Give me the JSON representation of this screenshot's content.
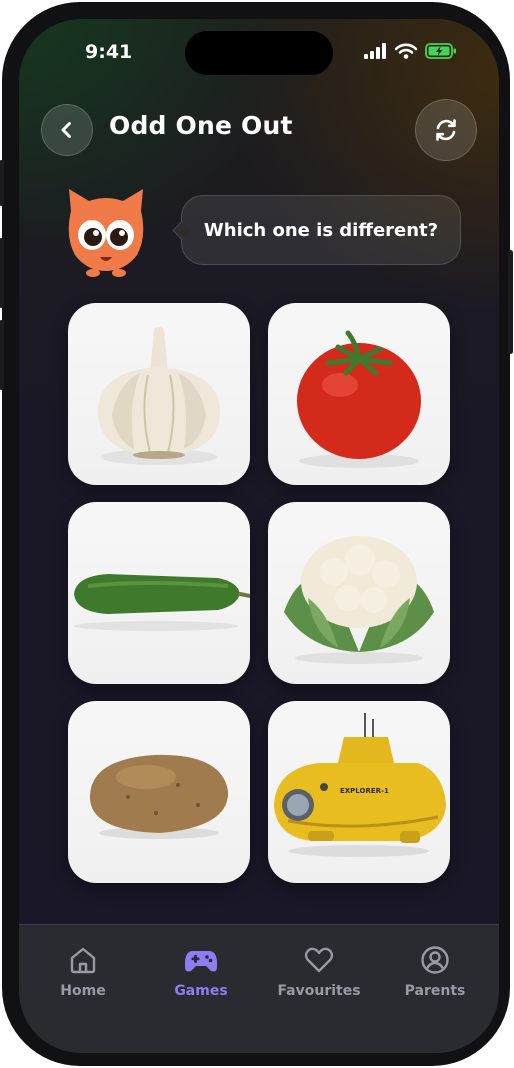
{
  "status_bar": {
    "time": "9:41"
  },
  "header": {
    "title": "Odd One Out"
  },
  "prompt": {
    "text": "Which one is different?"
  },
  "cards": [
    {
      "item": "garlic"
    },
    {
      "item": "tomato"
    },
    {
      "item": "cucumber"
    },
    {
      "item": "cauliflower"
    },
    {
      "item": "potato"
    },
    {
      "item": "submarine",
      "caption": "EXPLORER-1"
    }
  ],
  "nav": {
    "items": [
      {
        "label": "Home",
        "icon": "home-icon",
        "active": false
      },
      {
        "label": "Games",
        "icon": "gamepad-icon",
        "active": true
      },
      {
        "label": "Favourites",
        "icon": "heart-icon",
        "active": false
      },
      {
        "label": "Parents",
        "icon": "user-circle-icon",
        "active": false
      }
    ]
  },
  "colors": {
    "accent": "#8d7cf2",
    "mascot": "#f07a48",
    "nav_background": "#2a2a31",
    "battery": "#41d35a"
  }
}
